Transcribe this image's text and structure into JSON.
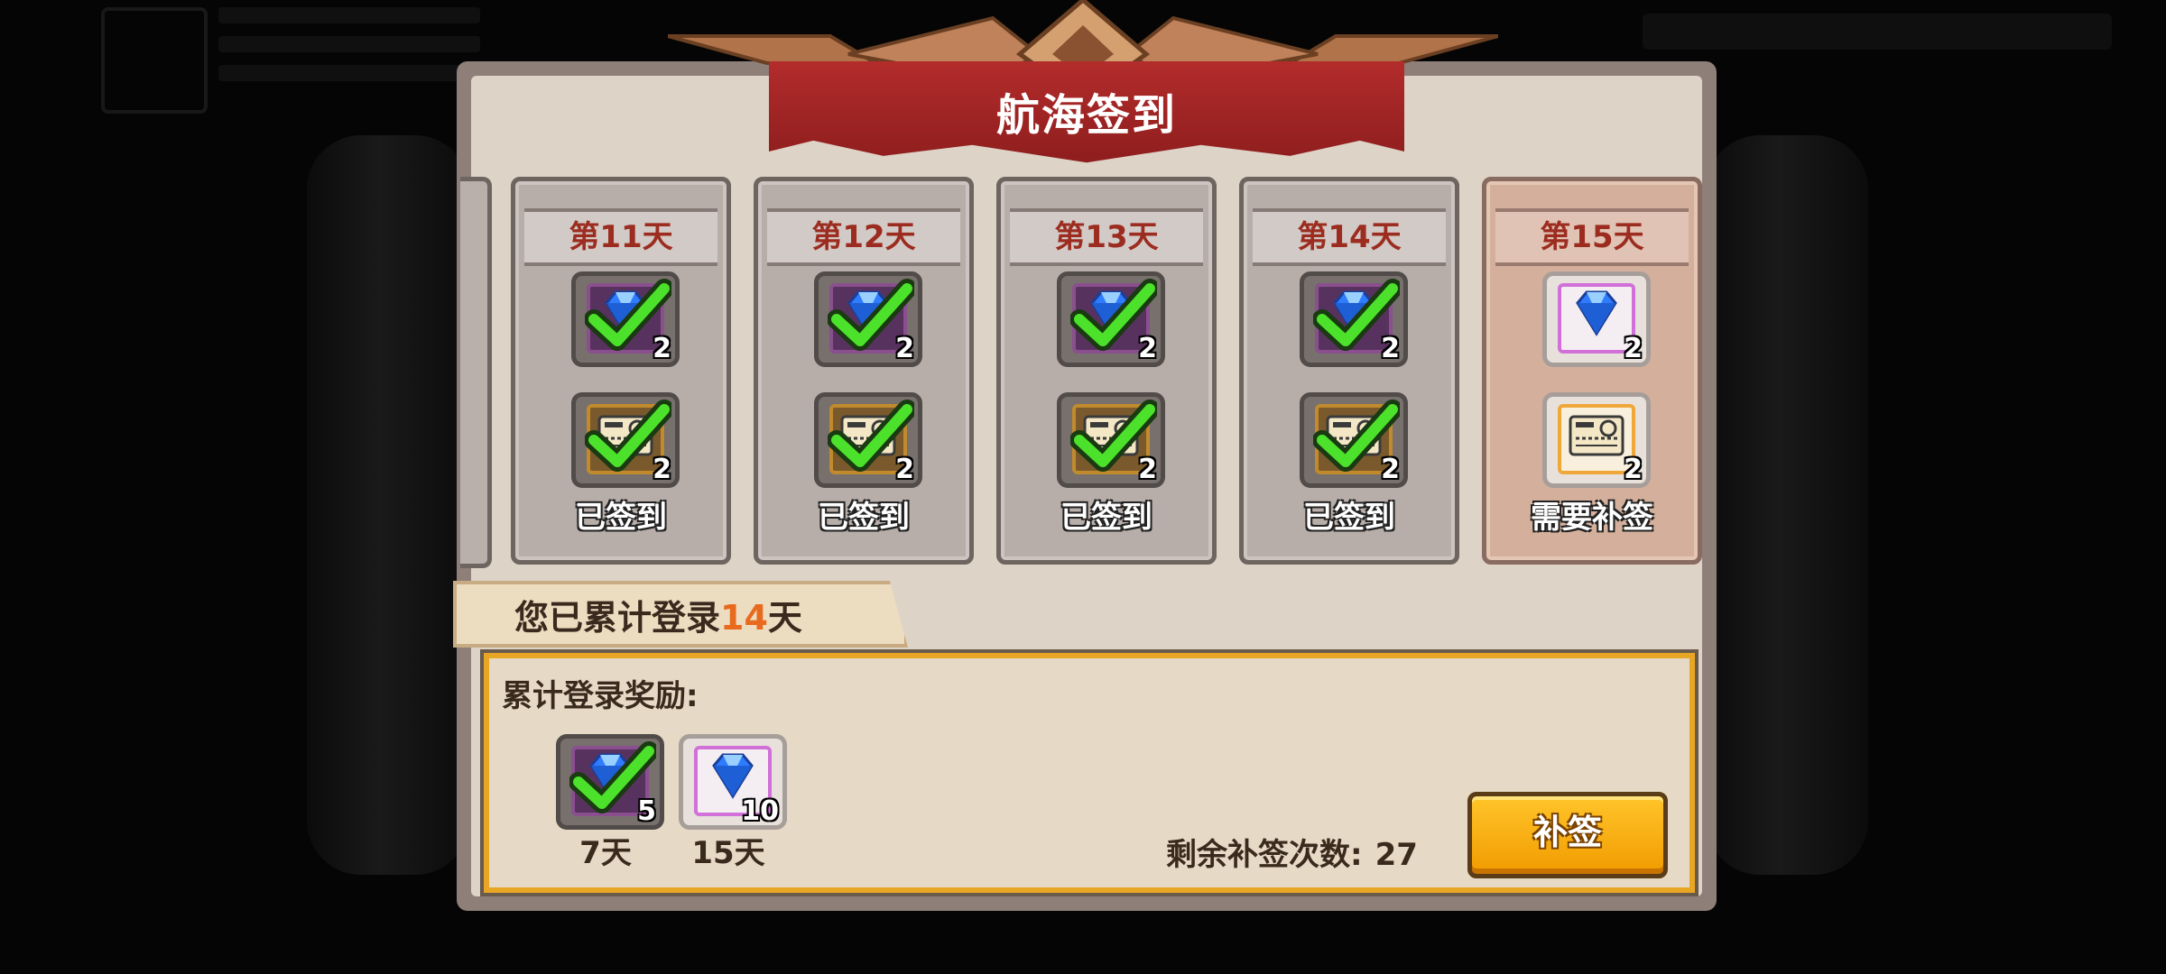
{
  "title": "航海签到",
  "days": [
    {
      "label": "第11天",
      "rewards": [
        {
          "icon": "gem-icon",
          "qty": "2",
          "claimed": true
        },
        {
          "icon": "ticket-icon",
          "qty": "2",
          "claimed": true
        }
      ],
      "status": "已签到"
    },
    {
      "label": "第12天",
      "rewards": [
        {
          "icon": "gem-icon",
          "qty": "2",
          "claimed": true
        },
        {
          "icon": "ticket-icon",
          "qty": "2",
          "claimed": true
        }
      ],
      "status": "已签到"
    },
    {
      "label": "第13天",
      "rewards": [
        {
          "icon": "gem-icon",
          "qty": "2",
          "claimed": true
        },
        {
          "icon": "ticket-icon",
          "qty": "2",
          "claimed": true
        }
      ],
      "status": "已签到"
    },
    {
      "label": "第14天",
      "rewards": [
        {
          "icon": "gem-icon",
          "qty": "2",
          "claimed": true
        },
        {
          "icon": "ticket-icon",
          "qty": "2",
          "claimed": true
        }
      ],
      "status": "已签到"
    },
    {
      "label": "第15天",
      "rewards": [
        {
          "icon": "gem-icon",
          "qty": "2",
          "claimed": false
        },
        {
          "icon": "ticket-icon",
          "qty": "2",
          "claimed": false
        }
      ],
      "status": "需要补签"
    }
  ],
  "cumulative": {
    "prefix": "您已累计登录",
    "count": "14",
    "suffix": "天"
  },
  "reward_section": {
    "label": "累计登录奖励:",
    "items": [
      {
        "icon": "gem-icon",
        "qty": "5",
        "day": "7天",
        "claimed": true
      },
      {
        "icon": "gem-icon",
        "qty": "10",
        "day": "15天",
        "claimed": false
      }
    ],
    "remaining_label": "剩余补签次数:",
    "remaining_count": "27"
  },
  "makeup_button": "补签",
  "colors": {
    "accent": "#f19b00",
    "title_banner": "#a32424",
    "day_label": "#9c2c20",
    "highlight_number": "#e86a1e"
  }
}
